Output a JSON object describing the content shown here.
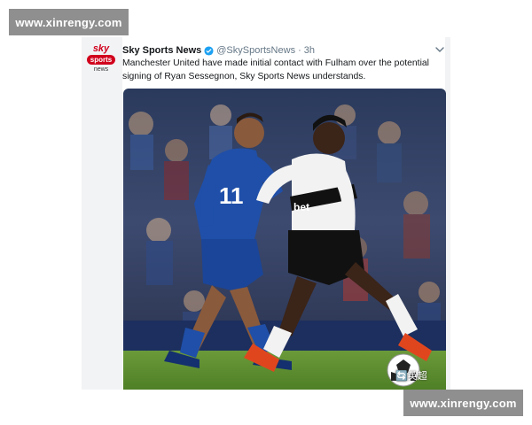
{
  "watermarks": {
    "top": "www.xinrengy.com",
    "bottom": "www.xinrengy.com"
  },
  "tweet": {
    "avatar": {
      "line1": "sky",
      "line2": "sports",
      "line3": "news"
    },
    "display_name": "Sky Sports News",
    "handle": "@SkySportsNews",
    "separator": "·",
    "time": "3h",
    "text": "Manchester United have made initial contact with Fulham over the potential signing of Ryan Sessegnon, Sky Sports News understands.",
    "photo": {
      "player_left_number": "11",
      "shirt_sponsor": "bet",
      "caption_overlay": "🔄英超"
    }
  },
  "colors": {
    "brand_red": "#d1001c",
    "verified_blue": "#1da1f2",
    "cardiff_blue": "#1f4fa8",
    "pitch_green": "#5a8a2e"
  },
  "icons": [
    "verified-badge-icon",
    "chevron-down-icon"
  ]
}
